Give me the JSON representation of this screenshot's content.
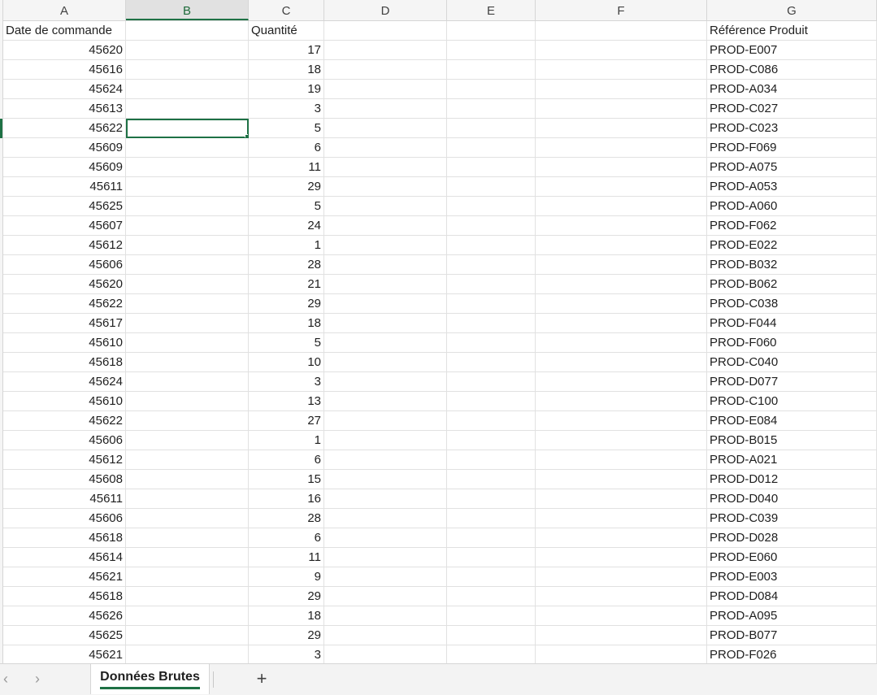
{
  "sheet": {
    "columns": [
      "A",
      "B",
      "C",
      "D",
      "E",
      "F",
      "G"
    ],
    "selected_column": "B",
    "headers": [
      "Date de commande",
      "",
      "Quantité",
      "",
      "",
      "",
      "Référence Produit"
    ],
    "rows": [
      [
        "45620",
        "17",
        "PROD-E007"
      ],
      [
        "45616",
        "18",
        "PROD-C086"
      ],
      [
        "45624",
        "19",
        "PROD-A034"
      ],
      [
        "45613",
        "3",
        "PROD-C027"
      ],
      [
        "45622",
        "5",
        "PROD-C023"
      ],
      [
        "45609",
        "6",
        "PROD-F069"
      ],
      [
        "45609",
        "11",
        "PROD-A075"
      ],
      [
        "45611",
        "29",
        "PROD-A053"
      ],
      [
        "45625",
        "5",
        "PROD-A060"
      ],
      [
        "45607",
        "24",
        "PROD-F062"
      ],
      [
        "45612",
        "1",
        "PROD-E022"
      ],
      [
        "45606",
        "28",
        "PROD-B032"
      ],
      [
        "45620",
        "21",
        "PROD-B062"
      ],
      [
        "45622",
        "29",
        "PROD-C038"
      ],
      [
        "45617",
        "18",
        "PROD-F044"
      ],
      [
        "45610",
        "5",
        "PROD-F060"
      ],
      [
        "45618",
        "10",
        "PROD-C040"
      ],
      [
        "45624",
        "3",
        "PROD-D077"
      ],
      [
        "45610",
        "13",
        "PROD-C100"
      ],
      [
        "45622",
        "27",
        "PROD-E084"
      ],
      [
        "45606",
        "1",
        "PROD-B015"
      ],
      [
        "45612",
        "6",
        "PROD-A021"
      ],
      [
        "45608",
        "15",
        "PROD-D012"
      ],
      [
        "45611",
        "16",
        "PROD-D040"
      ],
      [
        "45606",
        "28",
        "PROD-C039"
      ],
      [
        "45618",
        "6",
        "PROD-D028"
      ],
      [
        "45614",
        "11",
        "PROD-E060"
      ],
      [
        "45621",
        "9",
        "PROD-E003"
      ],
      [
        "45618",
        "29",
        "PROD-D084"
      ],
      [
        "45626",
        "18",
        "PROD-A095"
      ],
      [
        "45625",
        "29",
        "PROD-B077"
      ],
      [
        "45621",
        "3",
        "PROD-F026"
      ]
    ],
    "active_cell": "B6"
  },
  "tabs": {
    "prev_icon": "‹",
    "next_icon": "›",
    "sheets": [
      "Données Brutes"
    ],
    "add_icon": "+"
  },
  "colors": {
    "accent": "#1e7145"
  }
}
